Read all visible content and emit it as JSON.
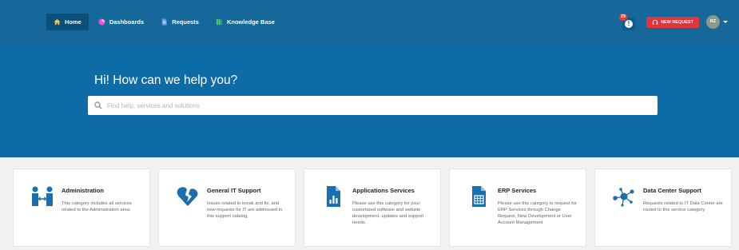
{
  "nav": {
    "items": [
      {
        "label": "Home",
        "icon": "home-icon",
        "active": true
      },
      {
        "label": "Dashboards",
        "icon": "dashboard-icon"
      },
      {
        "label": "Requests",
        "icon": "requests-icon"
      },
      {
        "label": "Knowledge Base",
        "icon": "book-icon"
      }
    ]
  },
  "header": {
    "notification_count": "29",
    "notification_symbol": "!",
    "new_request_label": "NEW REQUEST",
    "avatar_initials": "RZ"
  },
  "hero": {
    "title": "Hi! How can we help you?",
    "search_placeholder": "Find help, services and solutions"
  },
  "categories": [
    {
      "title": "Administration",
      "description": "This category includes all services related to the Administration area.",
      "icon": "people-exchange-icon"
    },
    {
      "title": "General IT Support",
      "description": "Issues related to break and fix, and new requests for IT are addressed in this support catalog.",
      "icon": "broken-heart-icon"
    },
    {
      "title": "Applications Services",
      "description": "Please use this category for your customized software and website development, updates and support needs.",
      "icon": "chart-document-icon"
    },
    {
      "title": "ERP Services",
      "description": "Please use this category to request for ERP Services through Change Request, New Development or User Account Management",
      "icon": "spreadsheet-document-icon"
    },
    {
      "title": "Data Center Support",
      "description": "Requests related to IT Data Center are routed to this service category",
      "icon": "network-hub-icon"
    }
  ],
  "colors": {
    "topbar": "#16679a",
    "hero": "#0d6ba6",
    "accent_icon": "#1a6fae",
    "new_request": "#e2343a",
    "nav_dashboards_icon": "#e056d3",
    "nav_requests_icon": "#5ea2f0",
    "nav_kb_icon": "#49c56c",
    "nav_home_icon": "#f5c542"
  }
}
